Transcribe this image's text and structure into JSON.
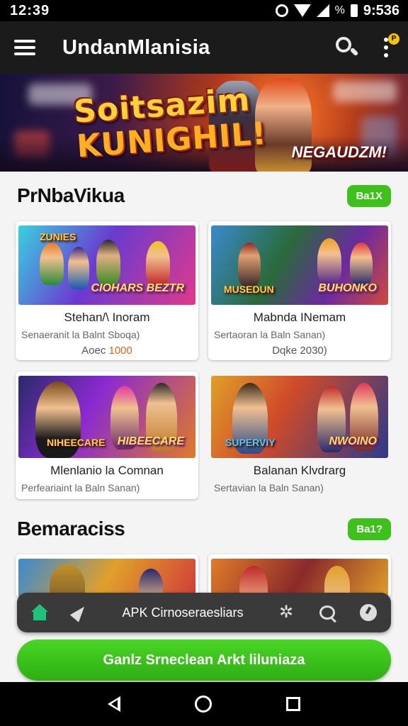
{
  "status_bar": {
    "time": "12:39",
    "battery_text": "%",
    "right_time": "9:536"
  },
  "app_bar": {
    "title": "UndanMlanisia"
  },
  "hero": {
    "line1": "Soitsazim",
    "line2": "KUNIGHIL!",
    "corner_text": "NEGAUDZM!"
  },
  "section1": {
    "title": "PrNbaVikua",
    "pill": "Ba1X",
    "cards": [
      {
        "name": "Stehan/\\ Inoram",
        "sub": "Senaeranit la Balnt Sboqa)",
        "price_prefix": "Aoec ",
        "price_value": "1000",
        "art_text": "CIOHARS BEZTR",
        "art_text2": "ZUNIES"
      },
      {
        "name": "Mabnda INemam",
        "sub": "Sertaoran la Baln Sanan)",
        "price_prefix": "Dqke ",
        "price_value": "2030)",
        "art_text": "BUHONKO",
        "art_text2": "MUSEDUN"
      },
      {
        "name": "Mlenlanio la Comnan",
        "sub": "Perfeariaint la Baln Sanan)",
        "art_text": "NIHEECARE",
        "art_text2": "HIBEECARE"
      },
      {
        "name": "Balanan Klvdrarg",
        "sub": "Sertavian la Baln Sanan)",
        "art_text": "NWOINO",
        "art_text2": "SUPERVIY"
      }
    ]
  },
  "section2": {
    "title": "Bemaraciss",
    "pill": "Ba1?"
  },
  "bottom_nav": {
    "label": "APK Cirnoseraesliars"
  },
  "cta": {
    "label": "Ganlz Srneclean Arkt liluniaza"
  },
  "colors": {
    "accent_green": "#3ec11a",
    "app_bar": "#1b1b1b",
    "price_accent": "#e8601a"
  }
}
